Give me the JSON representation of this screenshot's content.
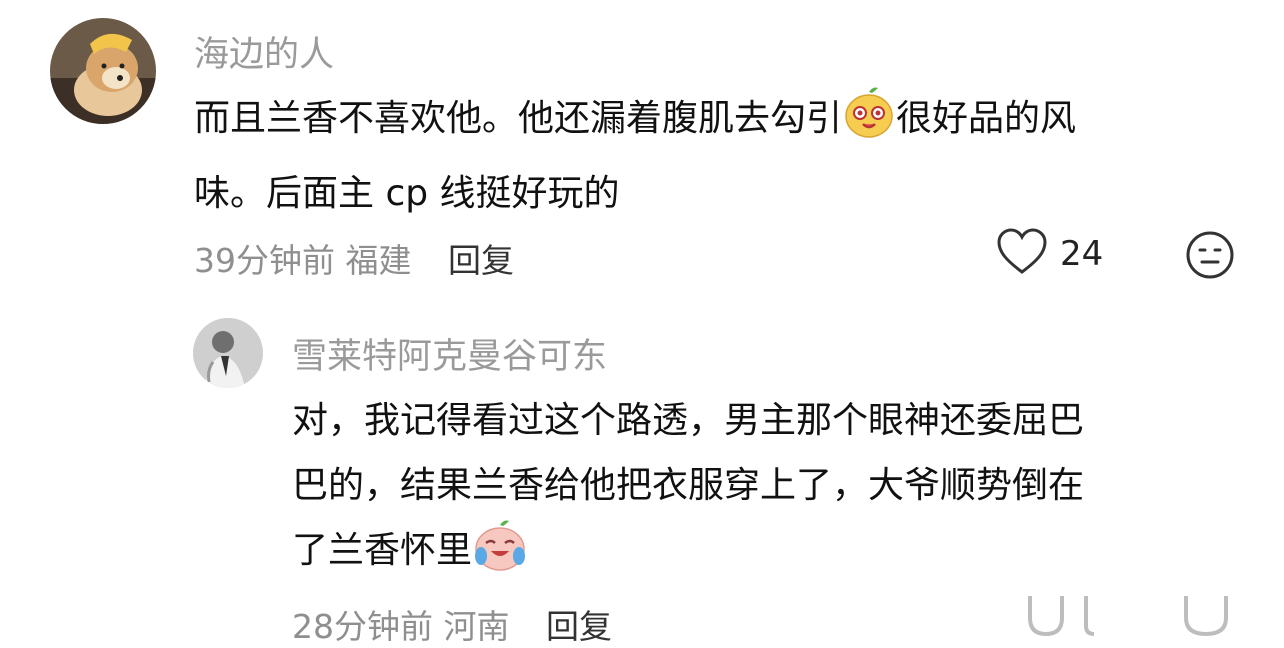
{
  "comments": [
    {
      "username": "海边的人",
      "avatar": "shiba-dog-avatar",
      "lines": [
        [
          "而且兰香不喜欢他。他还漏着腹肌去勾引",
          "emoji:yellow-face-emoji",
          "很好品的风"
        ],
        [
          "味。后面主 cp 线挺好玩的"
        ]
      ],
      "time": "39分钟前",
      "location": "福建",
      "reply_label": "回复",
      "likes": "24",
      "like_icon": "heart-outline-icon",
      "react_icon": "neutral-face-icon"
    },
    {
      "username": "雪莱特阿克曼谷可东",
      "avatar": "man-in-suit-avatar",
      "lines": [
        [
          "对，我记得看过这个路透，男主那个眼神还委屈巴"
        ],
        [
          "巴的，结果兰香给他把衣服穿上了，大爷顺势倒在"
        ],
        [
          "了兰香怀里",
          "emoji:laugh-cry-emoji"
        ]
      ],
      "time": "28分钟前",
      "location": "河南",
      "reply_label": "回复"
    }
  ]
}
